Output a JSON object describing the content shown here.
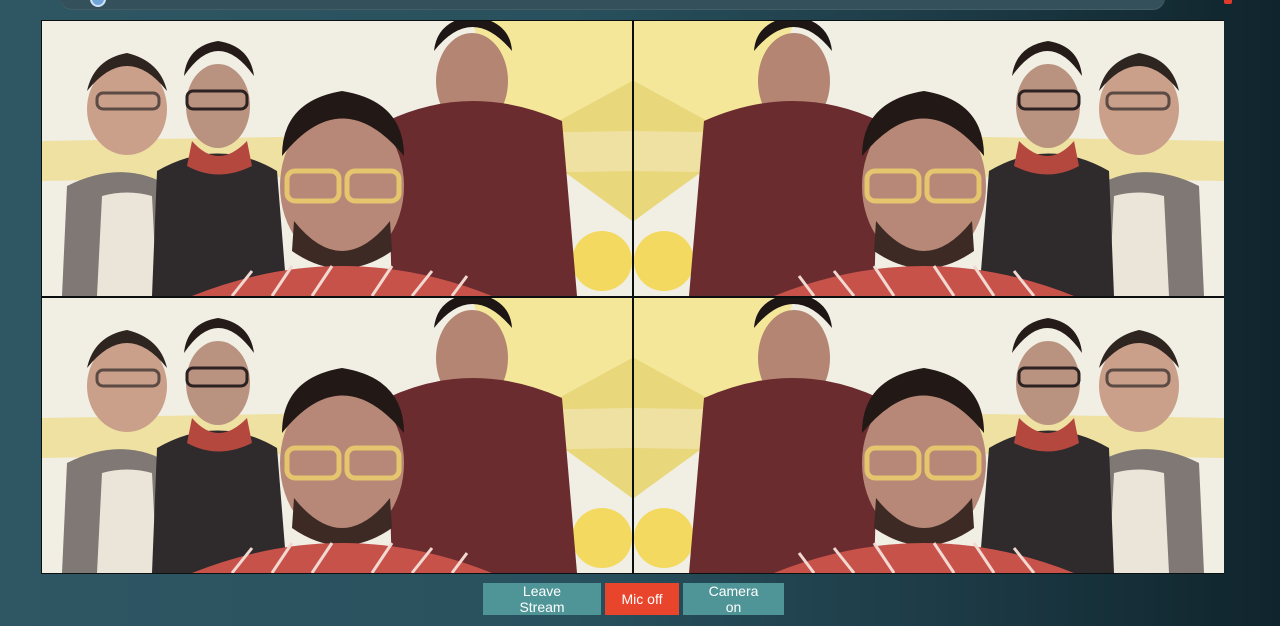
{
  "controls": {
    "leave_label": "Leave Stream",
    "mic_label": "Mic off",
    "camera_label": "Camera on"
  },
  "colors": {
    "mic_off_accent": "#e9452c",
    "button_teal": "#4f9597"
  },
  "video_tiles": [
    {
      "mirrored": false
    },
    {
      "mirrored": true
    },
    {
      "mirrored": false
    },
    {
      "mirrored": true
    }
  ]
}
